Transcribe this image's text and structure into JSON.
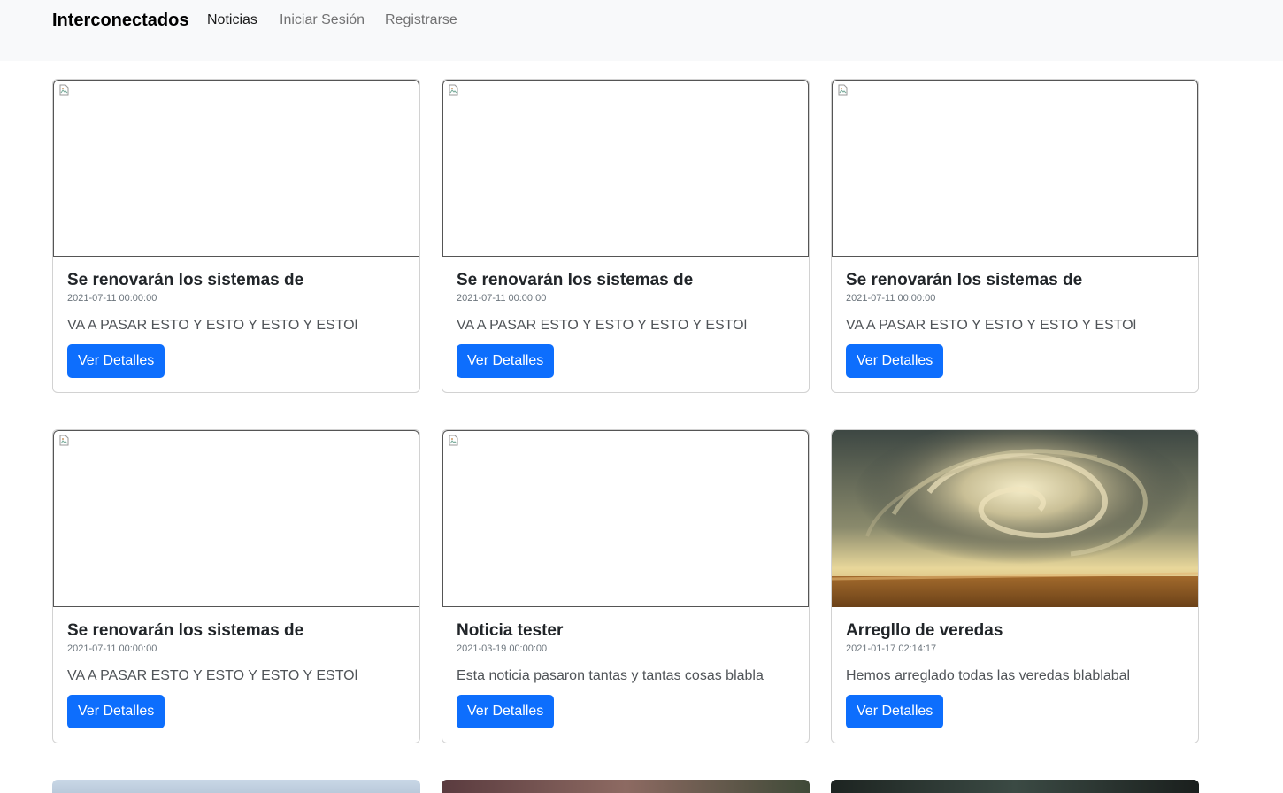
{
  "navbar": {
    "brand": "Interconectados",
    "links": [
      {
        "label": "Noticias",
        "active": true
      },
      {
        "label": "Iniciar Sesión",
        "active": false
      },
      {
        "label": "Registrarse",
        "active": false
      }
    ]
  },
  "cards": [
    {
      "title": "Se renovarán los sistemas de",
      "date": "2021-07-11 00:00:00",
      "text": "VA A PASAR ESTO Y ESTO Y ESTO Y ESTOl",
      "button": "Ver Detalles",
      "image": "broken-image-icon"
    },
    {
      "title": "Se renovarán los sistemas de",
      "date": "2021-07-11 00:00:00",
      "text": "VA A PASAR ESTO Y ESTO Y ESTO Y ESTOl",
      "button": "Ver Detalles",
      "image": "broken-image-icon"
    },
    {
      "title": "Se renovarán los sistemas de",
      "date": "2021-07-11 00:00:00",
      "text": "VA A PASAR ESTO Y ESTO Y ESTO Y ESTOl",
      "button": "Ver Detalles",
      "image": "broken-image-icon"
    },
    {
      "title": "Se renovarán los sistemas de",
      "date": "2021-07-11 00:00:00",
      "text": "VA A PASAR ESTO Y ESTO Y ESTO Y ESTOl",
      "button": "Ver Detalles",
      "image": "broken-image-icon"
    },
    {
      "title": "Noticia tester",
      "date": "2021-03-19 00:00:00",
      "text": "Esta noticia pasaron tantas y tantas cosas blabla",
      "button": "Ver Detalles",
      "image": "broken-image-icon"
    },
    {
      "title": "Arregllo de veredas",
      "date": "2021-01-17 02:14:17",
      "text": "Hemos arreglado todas las veredas blablabal",
      "button": "Ver Detalles",
      "image": "storm-cloud-photo"
    }
  ],
  "colors": {
    "primary": "#0d6efd",
    "navbar_bg": "#f8f9fa",
    "muted": "#6c757d"
  }
}
